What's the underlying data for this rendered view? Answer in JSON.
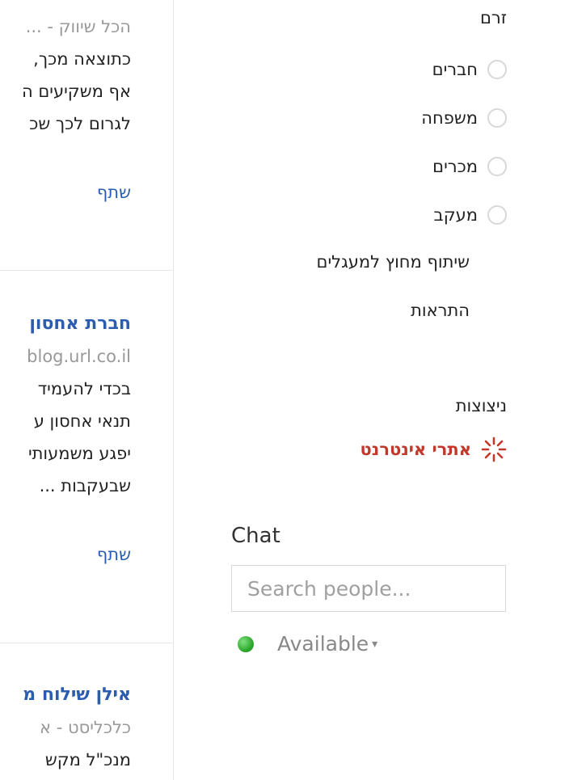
{
  "feed": {
    "posts": [
      {
        "meta": "הכל שיווק  -  ...",
        "lines": [
          "כתוצאה מכך,",
          "אף משקיעים ה",
          "לגרום לכך שכ"
        ],
        "share": "שתף"
      },
      {
        "title": "חברת אחסון",
        "meta": "blog.url.co.il",
        "lines": [
          "בכדי להעמיד",
          "תנאי אחסון ע",
          "יפגע משמעותי",
          "שבעקבות ..."
        ],
        "share": "שתף"
      },
      {
        "title": "אילן שילוח מ",
        "meta": "כלכליסט  -  א",
        "lines": [
          "מנכ\"ל מקש"
        ]
      }
    ]
  },
  "stream": {
    "heading": "זרם",
    "circles": [
      {
        "label": "חברים"
      },
      {
        "label": "משפחה"
      },
      {
        "label": "מכרים"
      },
      {
        "label": "מעקב"
      }
    ],
    "outside_circles": "שיתוף מחוץ למעגלים",
    "notifications": "התראות"
  },
  "sparks": {
    "heading": "ניצוצות",
    "item": "אתרי אינטרנט",
    "item_color": "#c0392b"
  },
  "chat": {
    "title": "Chat",
    "search_placeholder": "Search people...",
    "status": "Available",
    "status_color": "#2eaa2e"
  }
}
